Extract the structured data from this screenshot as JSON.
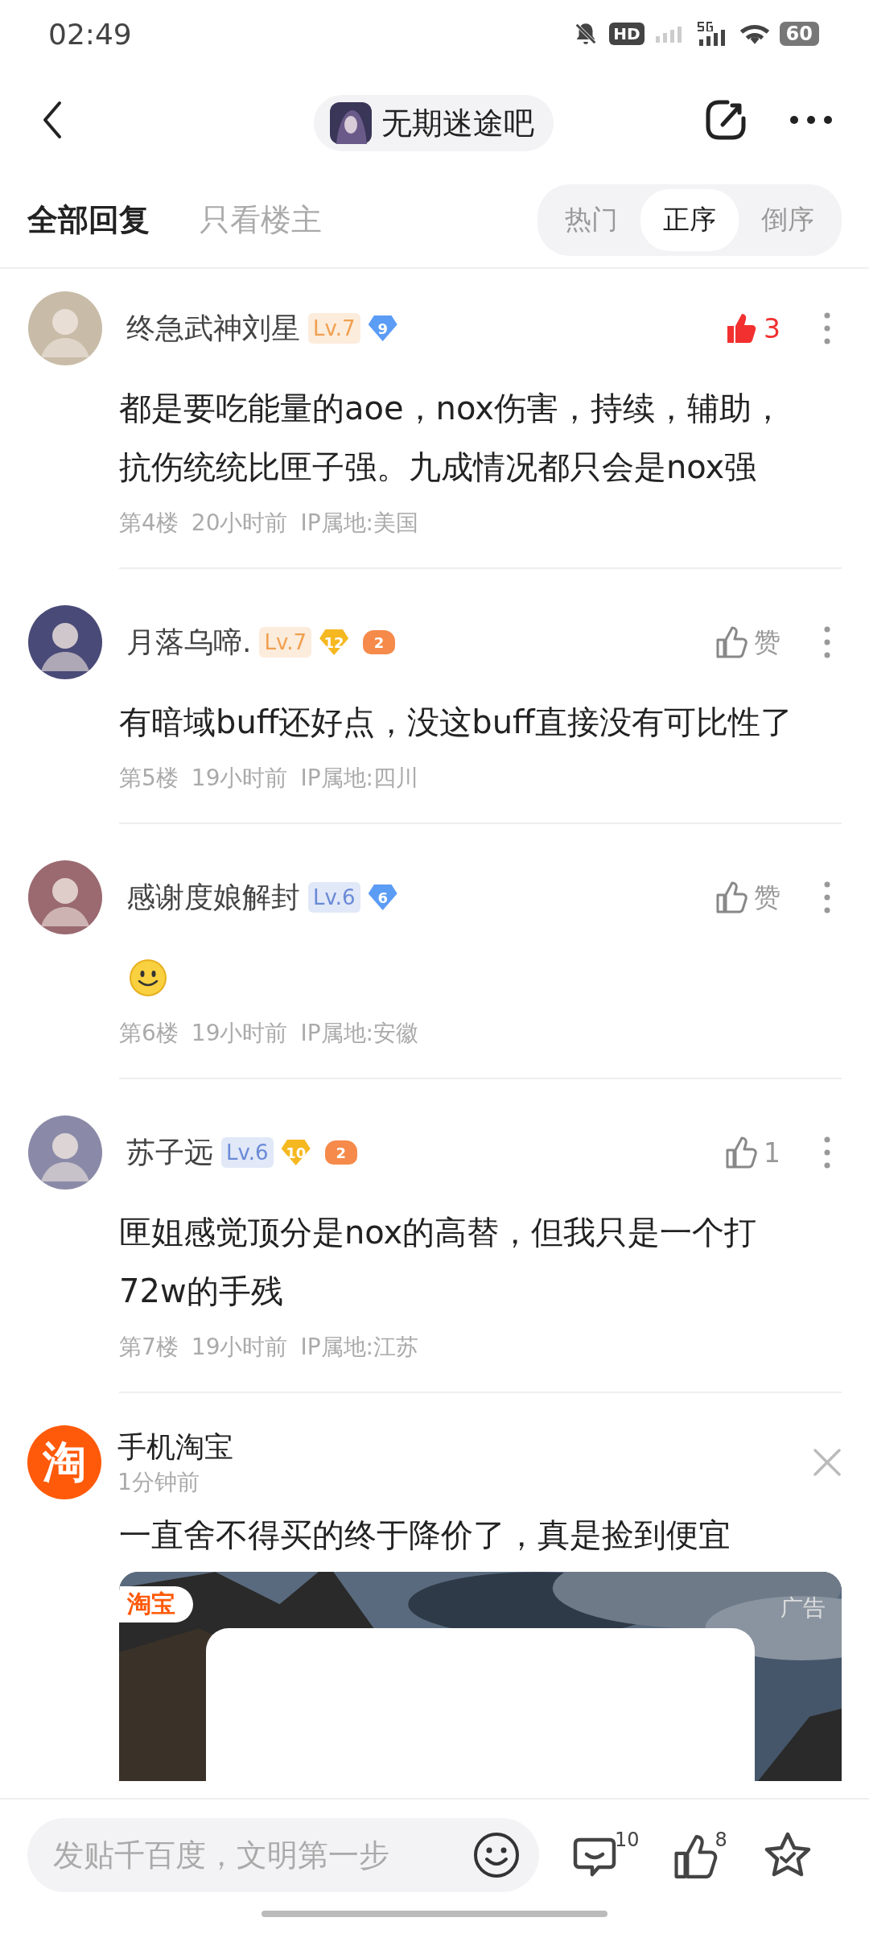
{
  "status_bar": {
    "time": "02:49",
    "hd_label": "HD",
    "battery": "60"
  },
  "nav": {
    "forum_name": "无期迷途吧"
  },
  "tabs": [
    {
      "label": "全部回复",
      "selected": true
    },
    {
      "label": "只看楼主",
      "selected": false
    }
  ],
  "sort_options": [
    {
      "label": "热门",
      "selected": false
    },
    {
      "label": "正序",
      "selected": true
    },
    {
      "label": "倒序",
      "selected": false
    }
  ],
  "comments": [
    {
      "name": "终急武神刘星",
      "level": {
        "text": "Lv.7",
        "color": "#f0a050"
      },
      "badges": [
        {
          "kind": "diamond",
          "text": "9",
          "color": "#5b9cf5"
        }
      ],
      "liked": true,
      "like_label": "3",
      "content": {
        "kind": "text",
        "text": "都是要吃能量的aoe，nox伤害，持续，辅助，抗伤统统比匣子强。九成情况都只会是nox强"
      },
      "floor": "第4楼",
      "time": "20小时前",
      "ip": "IP属地:美国"
    },
    {
      "name": "月落乌啼.",
      "level": {
        "text": "Lv.7",
        "color": "#f0a050"
      },
      "badges": [
        {
          "kind": "diamond",
          "text": "12",
          "color": "#f5b820"
        },
        {
          "kind": "gamepad",
          "text": "2",
          "color": "#f58a4a"
        }
      ],
      "liked": false,
      "like_label": "赞",
      "content": {
        "kind": "text",
        "text": "有暗域buff还好点，没这buff直接没有可比性了"
      },
      "floor": "第5楼",
      "time": "19小时前",
      "ip": "IP属地:四川"
    },
    {
      "name": "感谢度娘解封",
      "level": {
        "text": "Lv.6",
        "color": "#6a8ad8"
      },
      "badges": [
        {
          "kind": "diamond",
          "text": "6",
          "color": "#5b9cf5"
        }
      ],
      "liked": false,
      "like_label": "赞",
      "content": {
        "kind": "emoji"
      },
      "floor": "第6楼",
      "time": "19小时前",
      "ip": "IP属地:安徽"
    },
    {
      "name": "苏子远",
      "level": {
        "text": "Lv.6",
        "color": "#6a8ad8"
      },
      "badges": [
        {
          "kind": "diamond",
          "text": "10",
          "color": "#f5b820"
        },
        {
          "kind": "gamepad",
          "text": "2",
          "color": "#f58a4a"
        }
      ],
      "liked": false,
      "like_label": "1",
      "content": {
        "kind": "text",
        "text": "匣姐感觉顶分是nox的高替，但我只是一个打72w的手残"
      },
      "floor": "第7楼",
      "time": "19小时前",
      "ip": "IP属地:江苏"
    }
  ],
  "ad": {
    "logo_text": "淘",
    "name": "手机淘宝",
    "time": "1分钟前",
    "text": "一直舍不得买的终于降价了，真是捡到便宜",
    "tag": "淘宝",
    "label": "广告"
  },
  "bottom_bar": {
    "placeholder": "发贴千百度，文明第一步",
    "comment_count": "10",
    "like_count": "8"
  }
}
